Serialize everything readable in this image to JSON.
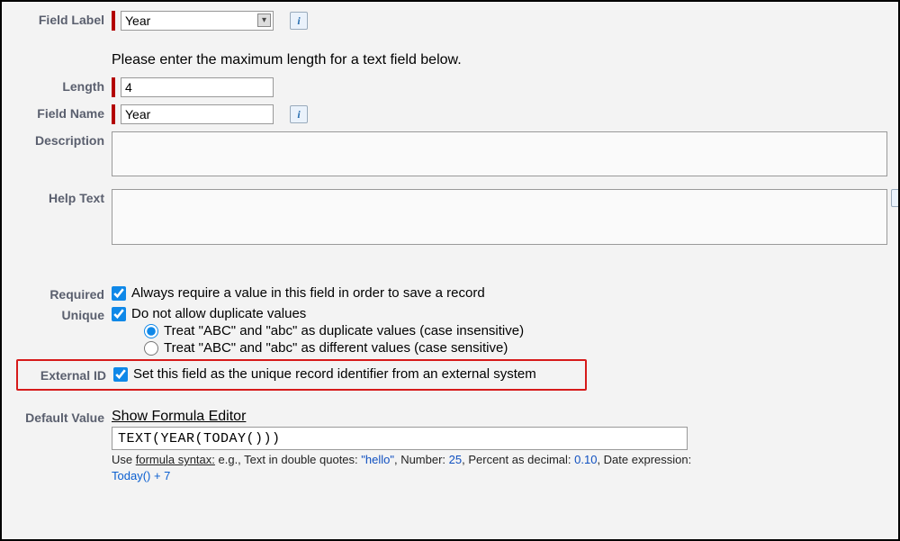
{
  "labels": {
    "field_label": "Field Label",
    "length": "Length",
    "field_name": "Field Name",
    "description": "Description",
    "help_text": "Help Text",
    "required": "Required",
    "unique": "Unique",
    "external_id": "External ID",
    "default_value": "Default Value"
  },
  "values": {
    "field_label": "Year",
    "length": "4",
    "field_name": "Year",
    "description": "",
    "help_text": "",
    "default_formula": "TEXT(YEAR(TODAY()))"
  },
  "instruction": "Please enter the maximum length for a text field below.",
  "checkboxes": {
    "required_label": "Always require a value in this field in order to save a record",
    "unique_label": "Do not allow duplicate values",
    "case_insensitive_label": "Treat \"ABC\" and \"abc\" as duplicate values (case insensitive)",
    "case_sensitive_label": "Treat \"ABC\" and \"abc\" as different values (case sensitive)",
    "external_id_label": "Set this field as the unique record identifier from an external system"
  },
  "default_value_section": {
    "link": "Show Formula Editor",
    "help_prefix": "Use ",
    "help_u": "formula syntax:",
    "help_mid": " e.g., Text in double quotes: ",
    "help_str": "\"hello\"",
    "help_num_lbl": ", Number: ",
    "help_num": "25",
    "help_pct_lbl": ", Percent as decimal: ",
    "help_pct": "0.10",
    "help_date_lbl": ", Date expression:",
    "help_date_expr": "Today() + 7"
  },
  "info_glyph": "i"
}
